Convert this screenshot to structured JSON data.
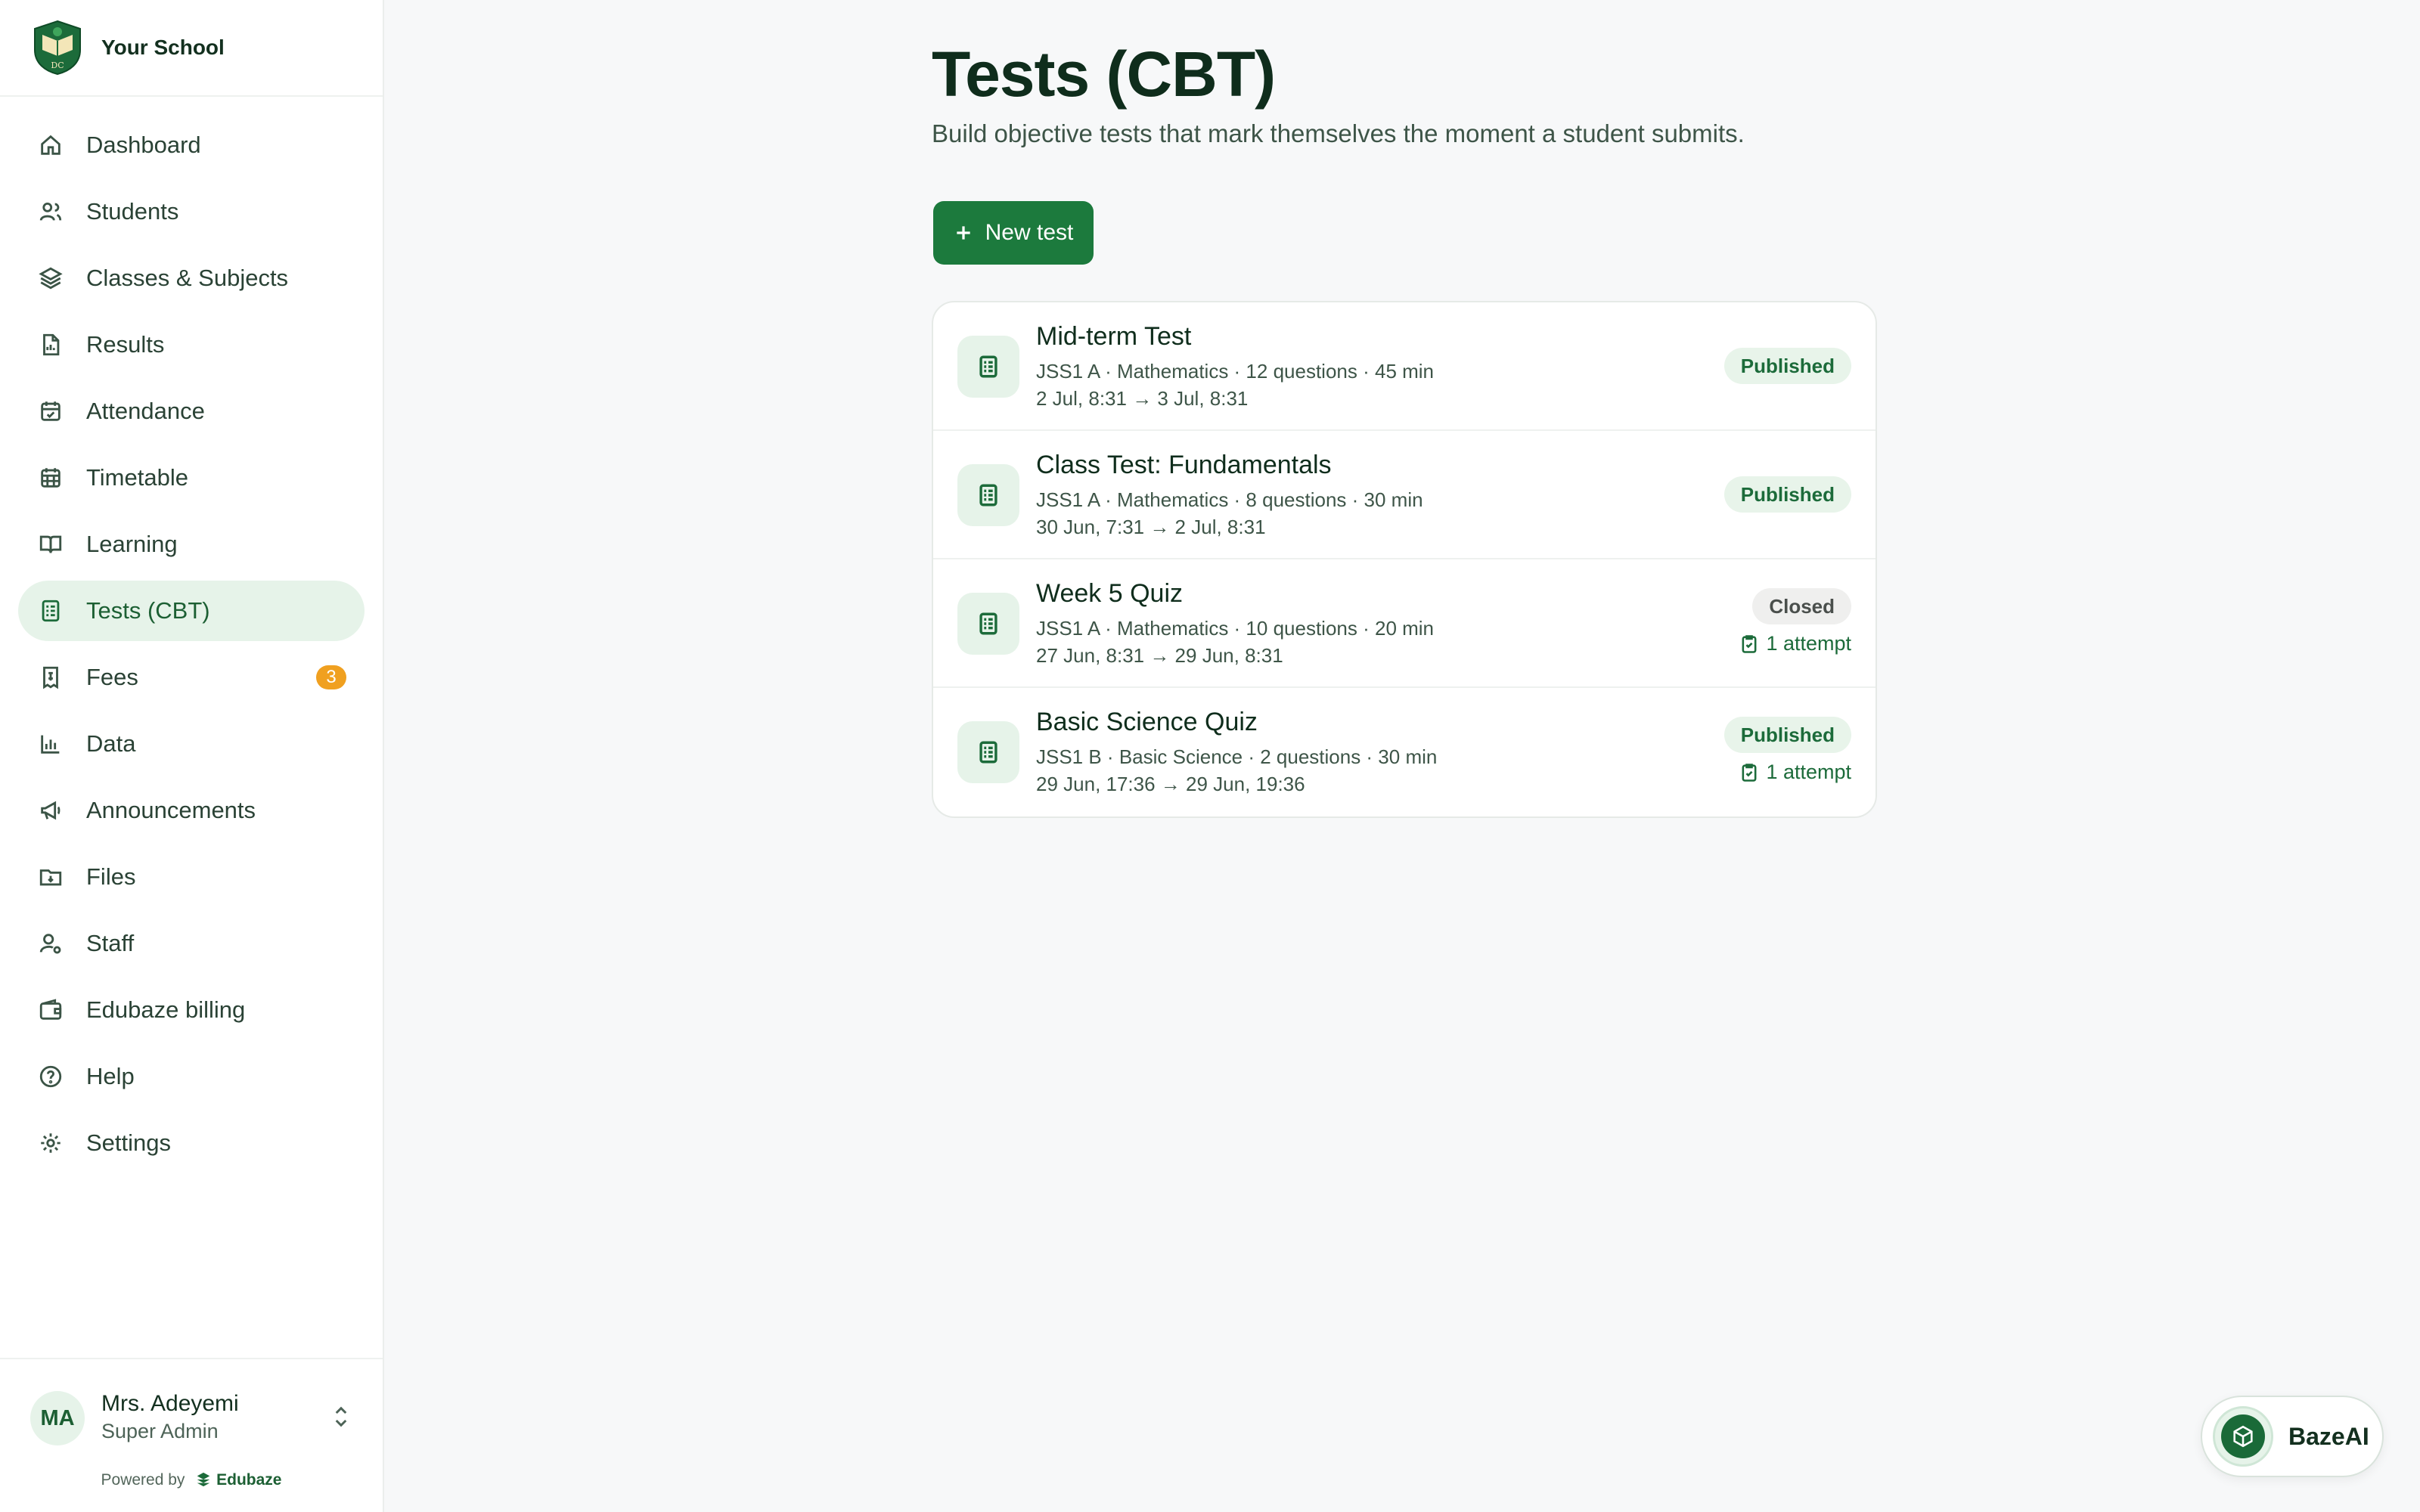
{
  "brand": {
    "name": "Your School",
    "logo_text": "DC"
  },
  "sidebar": {
    "items": [
      {
        "label": "Dashboard",
        "icon": "home-icon"
      },
      {
        "label": "Students",
        "icon": "users-icon"
      },
      {
        "label": "Classes & Subjects",
        "icon": "layers-icon"
      },
      {
        "label": "Results",
        "icon": "file-chart-icon"
      },
      {
        "label": "Attendance",
        "icon": "calendar-check-icon"
      },
      {
        "label": "Timetable",
        "icon": "calendar-grid-icon"
      },
      {
        "label": "Learning",
        "icon": "book-open-icon"
      },
      {
        "label": "Tests (CBT)",
        "icon": "test-list-icon",
        "active": true
      },
      {
        "label": "Fees",
        "icon": "receipt-icon",
        "badge": "3"
      },
      {
        "label": "Data",
        "icon": "bar-chart-icon"
      },
      {
        "label": "Announcements",
        "icon": "megaphone-icon"
      },
      {
        "label": "Files",
        "icon": "folder-icon"
      },
      {
        "label": "Staff",
        "icon": "user-gear-icon"
      },
      {
        "label": "Edubaze billing",
        "icon": "wallet-icon"
      },
      {
        "label": "Help",
        "icon": "help-circle-icon"
      },
      {
        "label": "Settings",
        "icon": "settings-icon"
      }
    ]
  },
  "user": {
    "initials": "MA",
    "name": "Mrs. Adeyemi",
    "role": "Super Admin",
    "powered_prefix": "Powered by",
    "powered_brand": "Edubaze"
  },
  "page": {
    "title": "Tests (CBT)",
    "subtitle": "Build objective tests that mark themselves the moment a student submits.",
    "new_button": "New test"
  },
  "tests": [
    {
      "title": "Mid-term Test",
      "meta": "JSS1 A · Mathematics · 12 questions · 45 min",
      "dates": "2 Jul, 8:31 → 3 Jul, 8:31",
      "status": "Published",
      "attempts": ""
    },
    {
      "title": "Class Test: Fundamentals",
      "meta": "JSS1 A · Mathematics · 8 questions · 30 min",
      "dates": "30 Jun, 7:31 → 2 Jul, 8:31",
      "status": "Published",
      "attempts": ""
    },
    {
      "title": "Week 5 Quiz",
      "meta": "JSS1 A · Mathematics · 10 questions · 20 min",
      "dates": "27 Jun, 8:31 → 29 Jun, 8:31",
      "status": "Closed",
      "attempts": "1 attempt"
    },
    {
      "title": "Basic Science Quiz",
      "meta": "JSS1 B · Basic Science · 2 questions · 30 min",
      "dates": "29 Jun, 17:36 → 29 Jun, 19:36",
      "status": "Published",
      "attempts": "1 attempt"
    }
  ],
  "assistant": {
    "label": "BazeAI"
  },
  "colors": {
    "accent": "#1c7a3d",
    "active_bg": "#e6f3e9",
    "badge": "#f0a020"
  }
}
